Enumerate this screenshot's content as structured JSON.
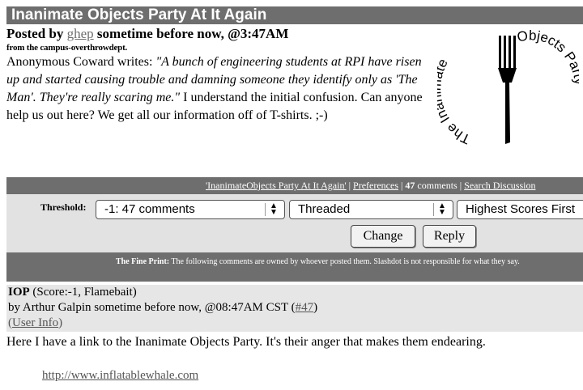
{
  "story": {
    "title": "Inanimate Objects Party At It Again",
    "posted_prefix": "Posted by ",
    "author": "ghep",
    "posted_suffix": " sometime before now, @3:47AM",
    "dept": "from the campus-overthrowdept.",
    "intro": "Anonymous Coward writes: ",
    "quote": "\"A bunch of engineering students at RPI have risen up and started causing trouble and damning someone they identify only as 'The Man'. They're really scaring me.\"",
    "body": " I understand the initial confusion. Can anyone help us out here? We get all our information off of T-shirts. ;-)"
  },
  "logo": {
    "text_left": "The Inanimate",
    "text_right": "Objects Party",
    "icon": "fork-icon"
  },
  "nav": {
    "story_link": "'InanimateObjects Party At It Again'",
    "sep1": " | ",
    "preferences": "Preferences",
    "sep2": " | ",
    "count": "47",
    "comments": " comments",
    "sep3": " | ",
    "search": "Search Discussion"
  },
  "controls": {
    "threshold_label": "Threshold:",
    "threshold_value": "-1: 47 comments",
    "mode_value": "Threaded",
    "sort_value": "Highest Scores First",
    "change_label": "Change",
    "reply_label": "Reply"
  },
  "fine_print": {
    "label": "The Fine Print:",
    "text": " The following comments are owned by whoever posted them. Slashdot is not responsible for what they say."
  },
  "comment": {
    "subject": "IOP",
    "score": " (Score:-1, Flamebait)",
    "byline": "by Arthur Galpin sometime before now, @08:47AM CST (",
    "number": "#47",
    "byline_close": ")",
    "user_open": "(",
    "user_info": "User Info",
    "user_close": ")",
    "body": "Here I have a link to the Inanimate Objects Party. It's their anger that makes them endearing.",
    "link": "http://www.inflatablewhale.com"
  }
}
